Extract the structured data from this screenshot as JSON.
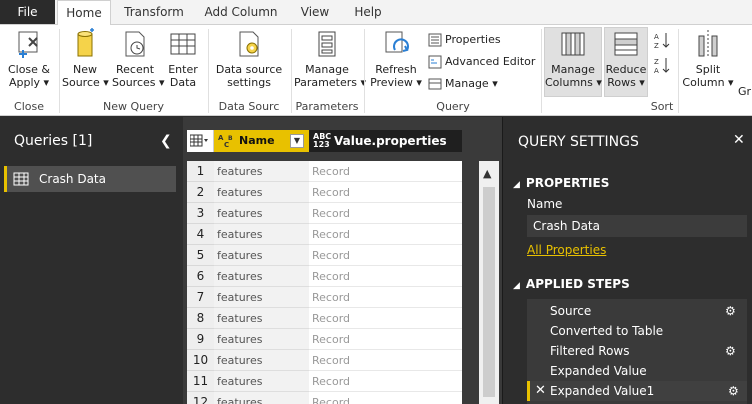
{
  "tabs": [
    {
      "label": "File"
    },
    {
      "label": "Home"
    },
    {
      "label": "Transform"
    },
    {
      "label": "Add Column"
    },
    {
      "label": "View"
    },
    {
      "label": "Help"
    }
  ],
  "ribbon": {
    "close_apply": {
      "line1": "Close &",
      "line2": "Apply ▾"
    },
    "group_close": "Close",
    "new_source": {
      "line1": "New",
      "line2": "Source ▾"
    },
    "recent_sources": {
      "line1": "Recent",
      "line2": "Sources ▾"
    },
    "enter_data": {
      "line1": "Enter",
      "line2": "Data"
    },
    "group_new_query": "New Query",
    "data_source_settings": {
      "line1": "Data source",
      "line2": "settings"
    },
    "group_data_source": "Data Sourc",
    "manage_parameters": {
      "line1": "Manage",
      "line2": "Parameters ▾"
    },
    "group_parameters": "Parameters",
    "refresh_preview": {
      "line1": "Refresh",
      "line2": "Preview ▾"
    },
    "properties": "Properties",
    "advanced_editor": "Advanced Editor",
    "manage": "Manage ▾",
    "group_query": "Query",
    "manage_columns": {
      "line1": "Manage",
      "line2": "Columns ▾"
    },
    "reduce_rows": {
      "line1": "Reduce",
      "line2": "Rows ▾"
    },
    "group_sort": "Sort",
    "split_column": {
      "line1": "Split",
      "line2": "Column ▾"
    },
    "group_by_partial": "Gr"
  },
  "queries": {
    "title": "Queries [1]",
    "items": [
      {
        "label": "Crash Data"
      }
    ]
  },
  "grid": {
    "columns": [
      {
        "name": "Name",
        "type": "A B C"
      },
      {
        "name": "Value.properties",
        "type_top": "ABC",
        "type_bottom": "123"
      }
    ],
    "rows": [
      {
        "num": "1",
        "name": "features",
        "value": "Record"
      },
      {
        "num": "2",
        "name": "features",
        "value": "Record"
      },
      {
        "num": "3",
        "name": "features",
        "value": "Record"
      },
      {
        "num": "4",
        "name": "features",
        "value": "Record"
      },
      {
        "num": "5",
        "name": "features",
        "value": "Record"
      },
      {
        "num": "6",
        "name": "features",
        "value": "Record"
      },
      {
        "num": "7",
        "name": "features",
        "value": "Record"
      },
      {
        "num": "8",
        "name": "features",
        "value": "Record"
      },
      {
        "num": "9",
        "name": "features",
        "value": "Record"
      },
      {
        "num": "10",
        "name": "features",
        "value": "Record"
      },
      {
        "num": "11",
        "name": "features",
        "value": "Record"
      },
      {
        "num": "12",
        "name": "features",
        "value": "Record"
      }
    ]
  },
  "settings": {
    "title": "QUERY SETTINGS",
    "properties_header": "PROPERTIES",
    "name_label": "Name",
    "name_value": "Crash Data",
    "all_properties": "All Properties",
    "applied_steps_header": "APPLIED STEPS",
    "steps": [
      {
        "label": "Source",
        "has_gear": true
      },
      {
        "label": "Converted to Table",
        "has_gear": false
      },
      {
        "label": "Filtered Rows",
        "has_gear": true
      },
      {
        "label": "Expanded Value",
        "has_gear": false
      },
      {
        "label": "Expanded Value1",
        "has_gear": true,
        "selected": true
      }
    ]
  },
  "colors": {
    "accent": "#e8c100",
    "dark_bg": "#2d2d2d",
    "file_tab": "#2b2b2b"
  }
}
